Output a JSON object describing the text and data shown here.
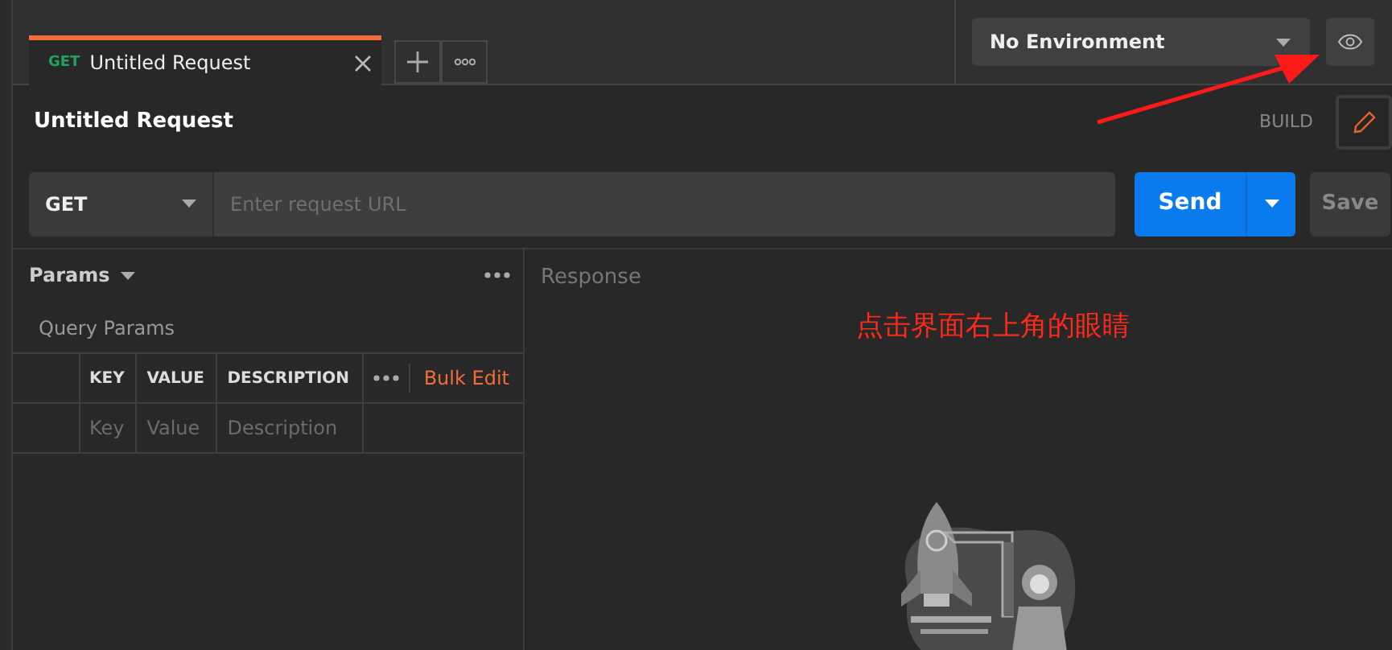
{
  "tabs": [
    {
      "method": "GET",
      "title": "Untitled Request",
      "selected": true
    }
  ],
  "environment": {
    "value": "No Environment"
  },
  "request": {
    "title": "Untitled Request",
    "mode": "BUILD",
    "method": "GET",
    "url_placeholder": "Enter request URL",
    "send": "Send",
    "save": "Save"
  },
  "params": {
    "title": "Params",
    "section": "Query Params",
    "columns": [
      "KEY",
      "VALUE",
      "DESCRIPTION"
    ],
    "bulk_edit": "Bulk Edit",
    "placeholders": [
      "Key",
      "Value",
      "Description"
    ]
  },
  "response": {
    "title": "Response"
  },
  "annotation": {
    "text": "点击界面右上角的眼睛"
  }
}
